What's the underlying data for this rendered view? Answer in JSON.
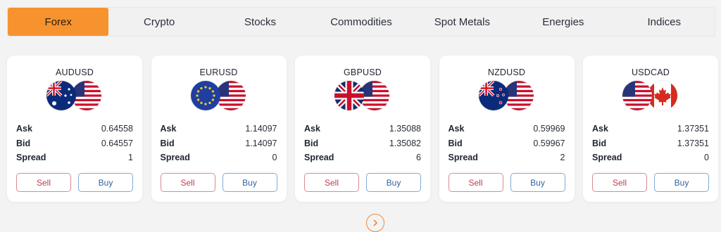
{
  "tabs": [
    {
      "label": "Forex",
      "active": true
    },
    {
      "label": "Crypto",
      "active": false
    },
    {
      "label": "Stocks",
      "active": false
    },
    {
      "label": "Commodities",
      "active": false
    },
    {
      "label": "Spot Metals",
      "active": false
    },
    {
      "label": "Energies",
      "active": false
    },
    {
      "label": "Indices",
      "active": false
    }
  ],
  "labels": {
    "ask": "Ask",
    "bid": "Bid",
    "spread": "Spread",
    "sell": "Sell",
    "buy": "Buy"
  },
  "cards": [
    {
      "pair": "AUDUSD",
      "ask": "0.64558",
      "bid": "0.64557",
      "spread": "1",
      "flags": [
        "australia-flag-icon",
        "usa-flag-icon"
      ]
    },
    {
      "pair": "EURUSD",
      "ask": "1.14097",
      "bid": "1.14097",
      "spread": "0",
      "flags": [
        "eu-flag-icon",
        "usa-flag-icon"
      ]
    },
    {
      "pair": "GBPUSD",
      "ask": "1.35088",
      "bid": "1.35082",
      "spread": "6",
      "flags": [
        "uk-flag-icon",
        "usa-flag-icon"
      ]
    },
    {
      "pair": "NZDUSD",
      "ask": "0.59969",
      "bid": "0.59967",
      "spread": "2",
      "flags": [
        "new-zealand-flag-icon",
        "usa-flag-icon"
      ]
    },
    {
      "pair": "USDCAD",
      "ask": "1.37351",
      "bid": "1.37351",
      "spread": "0",
      "flags": [
        "usa-flag-icon",
        "canada-flag-icon"
      ]
    }
  ],
  "colors": {
    "accent": "#f7932e",
    "sell": "#c0394e",
    "buy": "#2d64a8"
  },
  "nav": {
    "next_icon": "chevron-right-icon"
  }
}
